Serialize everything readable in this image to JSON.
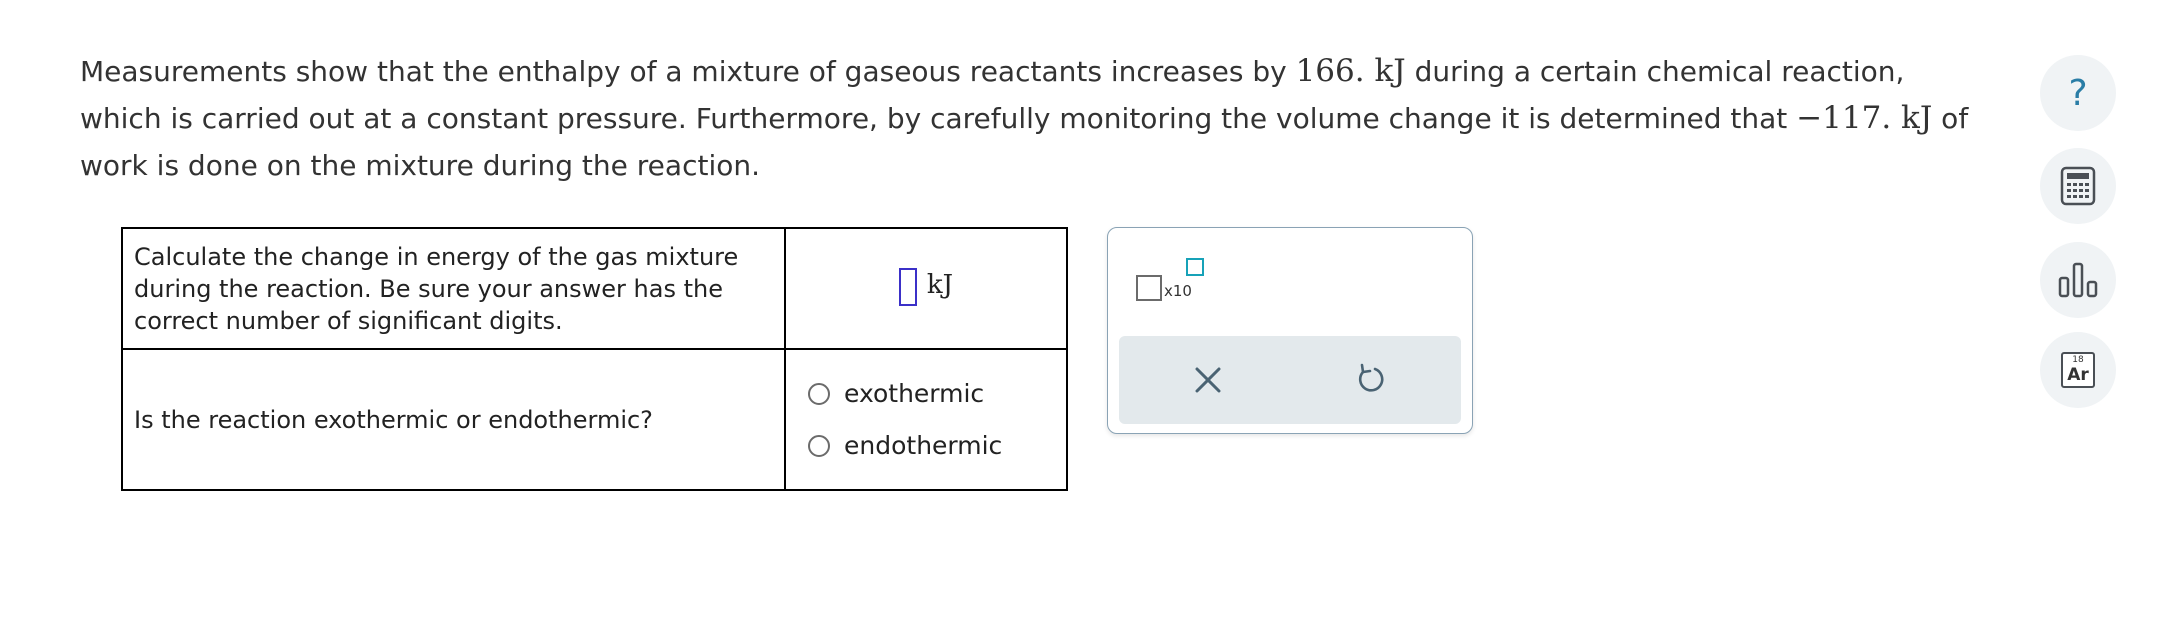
{
  "prompt": {
    "part1": "Measurements show that the enthalpy of a mixture of gaseous reactants increases by ",
    "value1": "166.",
    "unit1": " kJ",
    "part2": " during a certain chemical reaction, which is carried out at a constant pressure. Furthermore, by carefully monitoring the volume change it is determined that ",
    "value2": "−117.",
    "unit2": " kJ",
    "part3": " of work is done on the mixture during the reaction."
  },
  "questions": [
    {
      "text": "Calculate the change in energy of the gas mixture during the reaction. Be sure your answer has the correct number of significant digits.",
      "answer_value": "",
      "unit": "kJ"
    },
    {
      "text": "Is the reaction exothermic or endothermic?",
      "options": [
        "exothermic",
        "endothermic"
      ]
    }
  ],
  "tool_panel": {
    "sci_notation_label": "x10"
  },
  "sidebar": {
    "help_glyph": "?",
    "periodic_number": "18",
    "periodic_symbol": "Ar"
  },
  "colors": {
    "input_border": "#3b30c8",
    "exponent_accent": "#17a2b8",
    "action_bar_bg": "#e3e9ec",
    "action_icon": "#4a6373",
    "help_icon": "#2a7da6"
  }
}
